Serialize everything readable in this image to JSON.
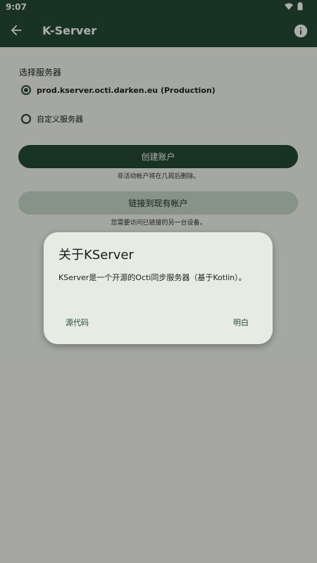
{
  "status_bar": {
    "time": "9:07"
  },
  "app_bar": {
    "title": "K-Server"
  },
  "content": {
    "section_label": "选择服务器",
    "options": [
      {
        "label": "prod.kserver.octi.darken.eu (Production)",
        "selected": true
      },
      {
        "label": "自定义服务器",
        "selected": false
      }
    ],
    "create_button": "创建账户",
    "create_hint": "非活动帐户将在几周后删除。",
    "link_button": "链接到现有帐户",
    "link_hint": "您需要访问已链接的另一台设备。"
  },
  "dialog": {
    "title": "关于KServer",
    "body": "KServer是一个开源的Octi同步服务器（基于Kotlin）。",
    "left_button": "源代码",
    "right_button": "明白"
  },
  "colors": {
    "primary": "#244c35",
    "secondary": "#c7d8cb",
    "dialog_bg": "#e6ebe4"
  }
}
